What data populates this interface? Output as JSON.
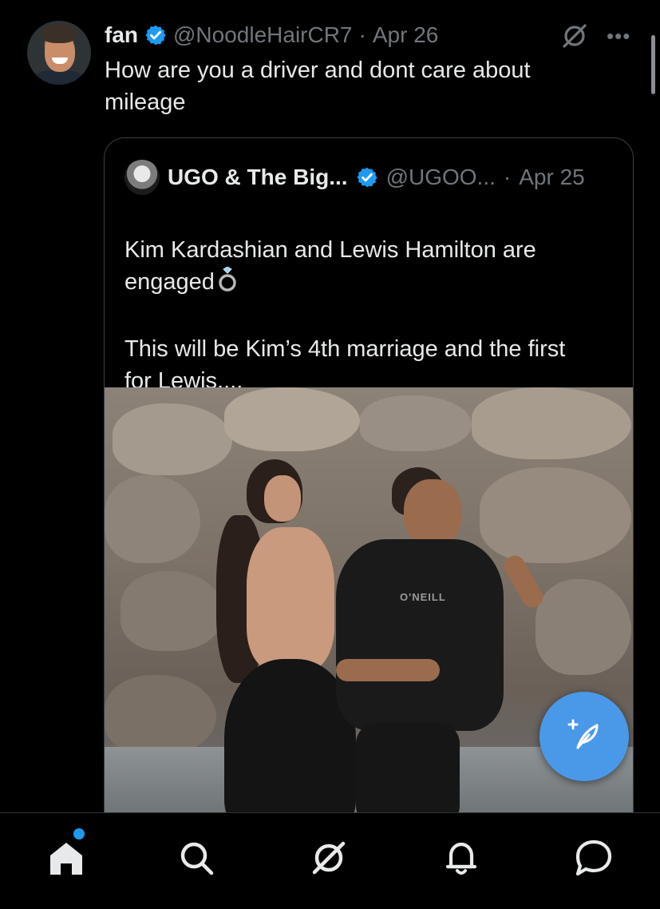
{
  "tweet": {
    "author_name": "fan",
    "author_handle": "@NoodleHairCR7",
    "separator": "·",
    "date": "Apr 26",
    "text": "How are you a driver and dont care about\nmileage",
    "verified": true
  },
  "quote": {
    "author_name": "UGO & The Big...",
    "author_handle": "@UGOO...",
    "separator": "·",
    "date": "Apr 25",
    "text_line1": "Kim Kardashian and Lewis Hamilton are\nengaged",
    "ring_emoji_name": "ring-icon",
    "text_line2": "This will be Kim’s 4th marriage and the first\nfor Lewis....",
    "verified": true,
    "photo_shirt_text": "O'NEILL"
  },
  "header_actions": {
    "grok_icon": "grok-icon",
    "more_label": "•••"
  },
  "fab": {
    "icon": "compose-post-icon",
    "plus": "+"
  },
  "bottom_nav": {
    "items": [
      "home-icon",
      "search-icon",
      "grok-icon",
      "notifications-icon",
      "messages-icon"
    ],
    "home_has_notification": true
  },
  "colors": {
    "background": "#000000",
    "text": "#e7e9ea",
    "secondary_text": "#71767b",
    "verified": "#1d9bf0",
    "fab": "#4a99e9",
    "border": "#3a3f44"
  }
}
